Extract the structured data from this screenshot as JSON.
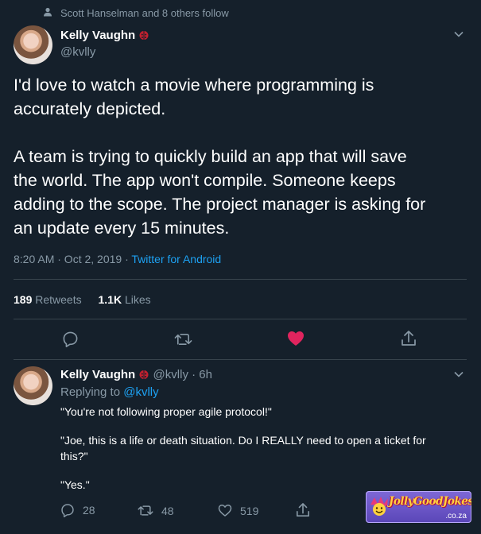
{
  "social_context": "Scott Hanselman and 8 others follow",
  "main_tweet": {
    "author_name": "Kelly Vaughn",
    "handle": "@kvlly",
    "text_line1": "I'd love to watch a movie where programming is",
    "text_line2": "accurately depicted.",
    "text_line3": "A team is trying to quickly build an app that will save",
    "text_line4": "the world. The app won't compile. Someone keeps",
    "text_line5": "adding to the scope. The project manager is asking for",
    "text_line6": "an update every 15 minutes.",
    "timestamp": "8:20 AM · Oct 2, 2019 · ",
    "source": "Twitter for Android",
    "retweets_count": "189",
    "retweets_label": "Retweets",
    "likes_count": "1.1K",
    "likes_label": "Likes"
  },
  "reply": {
    "author_name": "Kelly Vaughn",
    "handle_time": "@kvlly · 6h",
    "replying_label": "Replying to ",
    "replying_to": "@kvlly",
    "line1": "\"You're not following proper agile protocol!\"",
    "line2": "\"Joe, this is a life or death situation. Do I REALLY need to open a ticket for",
    "line3": "this?\"",
    "line4": "\"Yes.\"",
    "reply_count": "28",
    "retweet_count": "48",
    "like_count": "519"
  },
  "watermark": {
    "brand": "JollyGoodJokes",
    "tld": ".co.za"
  },
  "colors": {
    "background": "#15202b",
    "accent": "#1da1f2",
    "like": "#e0245e",
    "muted": "#8899a6",
    "divider": "#38444d"
  }
}
